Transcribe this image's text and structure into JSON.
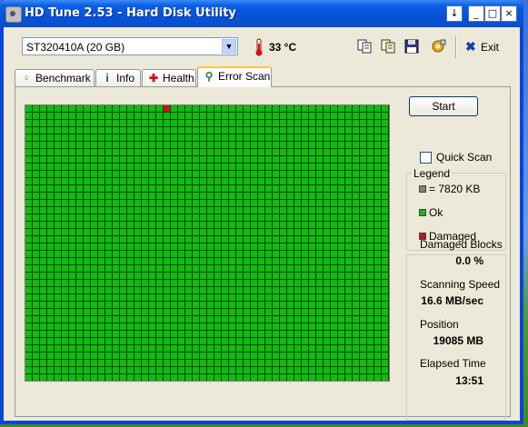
{
  "window": {
    "title": "HD Tune 2.53 - Hard Disk Utility"
  },
  "titlebar_buttons": {
    "dropdown": "↓",
    "minimize": "_",
    "maximize": "□",
    "close": "×"
  },
  "toolbar": {
    "drive": "ST320410A (20 GB)",
    "temperature": "33 °C",
    "exit_label": "Exit"
  },
  "tabs": [
    {
      "label": "Benchmark",
      "icon": "bulb-icon"
    },
    {
      "label": "Info",
      "icon": "info-icon"
    },
    {
      "label": "Health",
      "icon": "health-cross-icon"
    },
    {
      "label": "Error Scan",
      "icon": "magnifier-icon",
      "active": true
    }
  ],
  "scan": {
    "start_label": "Start",
    "quick_scan_label": "Quick Scan",
    "quick_scan_checked": false,
    "grid_state": {
      "columns": 50,
      "rows": 38,
      "damaged_cells": [
        [
          19,
          0
        ]
      ]
    }
  },
  "legend": {
    "title": "Legend",
    "block_size": "= 7820 KB",
    "ok": "Ok",
    "damaged": "Damaged",
    "colors": {
      "block": "#808080",
      "ok": "#11bb11",
      "damaged": "#c01818"
    }
  },
  "stats": {
    "damaged_blocks_label": "Damaged Blocks",
    "damaged_blocks_value": "0.0 %",
    "speed_label": "Scanning Speed",
    "speed_value": "16.6 MB/sec",
    "position_label": "Position",
    "position_value": "19085 MB",
    "elapsed_label": "Elapsed Time",
    "elapsed_value": "13:51"
  }
}
